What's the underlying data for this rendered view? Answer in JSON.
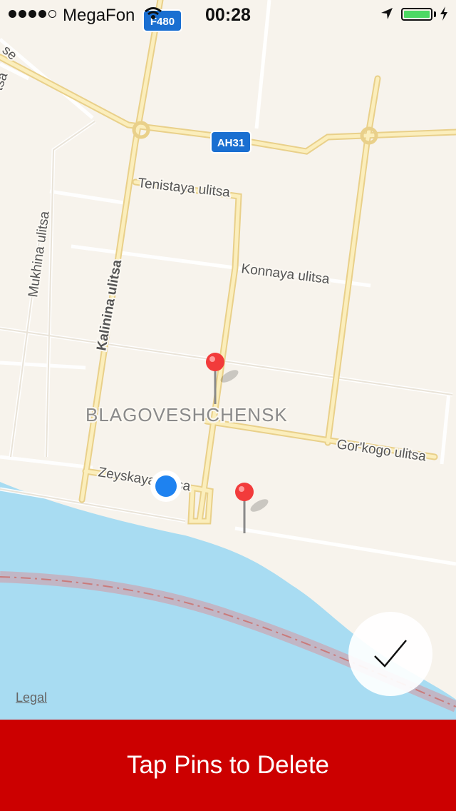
{
  "status_bar": {
    "carrier": "MegaFon",
    "time": "00:28",
    "signal_dots_filled": 4,
    "signal_dots_total": 5,
    "battery_level": 1.0
  },
  "map": {
    "city": "BLAGOVESHCHENSK",
    "road_shields": [
      "F480",
      "AH31"
    ],
    "streets": {
      "tenistaya": "Tenistaya ulitsa",
      "konnaya": "Konnaya ulitsa",
      "mukhina": "Mukhina ulitsa",
      "kalinina": "Kalinina ulitsa",
      "gorkogo": "Gor'kogo ulitsa",
      "zeyskaya": "Zeyskaya ulitsa"
    },
    "partial_labels": [
      "se",
      "tsa"
    ],
    "legal": "Legal",
    "pins": [
      "pin",
      "pin"
    ],
    "colors": {
      "land": "#f7f3ec",
      "water": "#a8dcf2",
      "major_road": "#f7e3a6",
      "pin": "#f23b3b",
      "user_location": "#1e82f0"
    }
  },
  "action_bar": {
    "label": "Tap Pins to Delete",
    "color": "#cc0000"
  }
}
